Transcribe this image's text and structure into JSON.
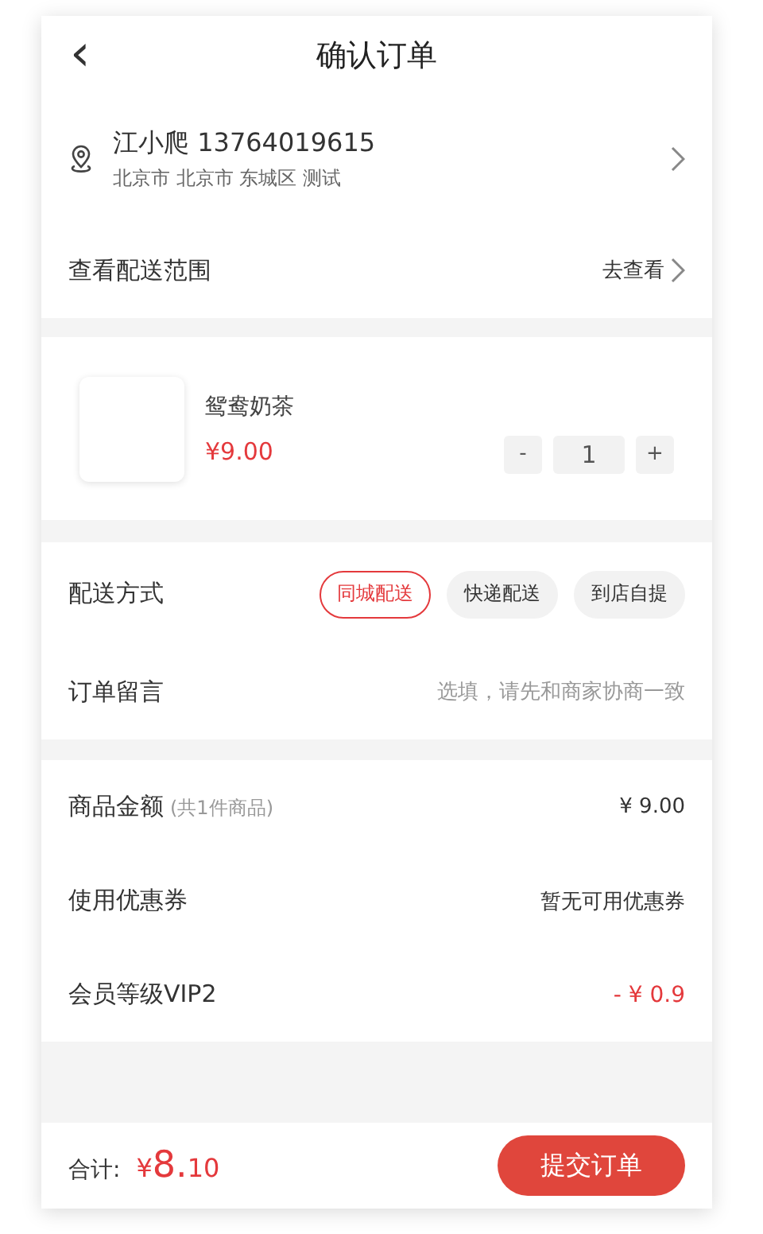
{
  "header": {
    "back": "‹",
    "title": "确认订单"
  },
  "address": {
    "name": "江小爬 13764019615",
    "detail": "北京市 北京市 东城区 测试"
  },
  "range": {
    "label": "查看配送范围",
    "link": "去查看"
  },
  "product": {
    "name": "鸳鸯奶茶",
    "price": "¥9.00",
    "minus": "-",
    "quantity": "1",
    "plus": "+"
  },
  "delivery": {
    "label": "配送方式",
    "options": [
      {
        "label": "同城配送",
        "selected": true
      },
      {
        "label": "快递配送",
        "selected": false
      },
      {
        "label": "到店自提",
        "selected": false
      }
    ]
  },
  "note": {
    "label": "订单留言",
    "placeholder": "选填，请先和商家协商一致"
  },
  "summary": [
    {
      "label": "商品金额",
      "hint": "(共1件商品)",
      "value": "¥ 9.00",
      "kind": "normal"
    },
    {
      "label": "使用优惠券",
      "value": "暂无可用优惠券",
      "kind": "normal"
    },
    {
      "label": "会员等级VIP2",
      "value": "- ¥ 0.9",
      "kind": "discount"
    }
  ],
  "footer": {
    "label": "合计:",
    "currency": "¥",
    "integer": "8.",
    "decimal": "10",
    "submit": "提交订单"
  }
}
